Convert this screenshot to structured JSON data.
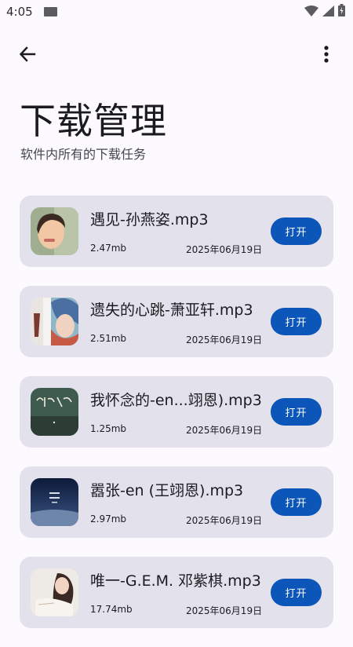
{
  "status_bar": {
    "time": "4:05"
  },
  "icons": {
    "back": "arrow-left-icon",
    "more": "more-vert-icon",
    "wifi": "wifi-icon",
    "signal": "signal-icon",
    "battery": "battery-icon"
  },
  "header": {
    "title": "下载管理",
    "subtitle": "软件内所有的下载任务"
  },
  "colors": {
    "background": "#fcf9ff",
    "card": "#e3e2ec",
    "accent": "#0b56b8"
  },
  "downloads": [
    {
      "name": "遇见-孙燕姿.mp3",
      "size": "2.47mb",
      "date": "2025年06月19日",
      "action": "打开"
    },
    {
      "name": "遗失的心跳-萧亚轩.mp3",
      "size": "2.51mb",
      "date": "2025年06月19日",
      "action": "打开"
    },
    {
      "name": "我怀念的-en...翊恩).mp3",
      "size": "1.25mb",
      "date": "2025年06月19日",
      "action": "打开"
    },
    {
      "name": "嚣张-en (王翊恩).mp3",
      "size": "2.97mb",
      "date": "2025年06月19日",
      "action": "打开"
    },
    {
      "name": "唯一-G.E.M. 邓紫棋.mp3",
      "size": "17.74mb",
      "date": "2025年06月19日",
      "action": "打开"
    }
  ]
}
